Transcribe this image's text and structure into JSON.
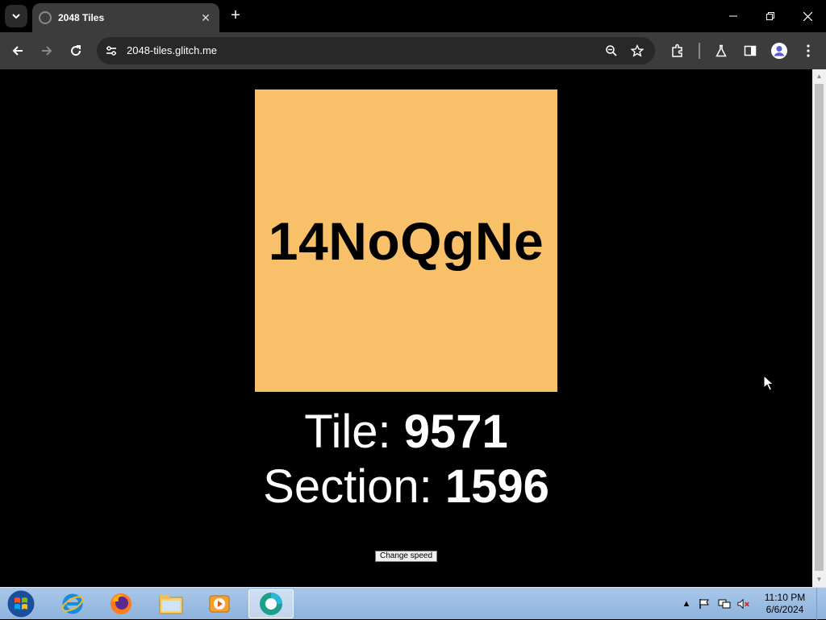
{
  "browser": {
    "tab_title": "2048 Tiles",
    "tab_close": "✕",
    "new_tab": "+",
    "url": "2048-tiles.glitch.me"
  },
  "page": {
    "tile_text": "14NoQgNe",
    "tile_color": "#f8c068",
    "tile_label": "Tile: ",
    "tile_value": "9571",
    "section_label": "Section: ",
    "section_value": "1596",
    "speed_button": "Change speed"
  },
  "taskbar": {
    "time": "11:10 PM",
    "date": "6/6/2024",
    "apps": [
      "start-orb",
      "internet-explorer",
      "firefox",
      "file-explorer",
      "media-player",
      "active-app"
    ]
  }
}
